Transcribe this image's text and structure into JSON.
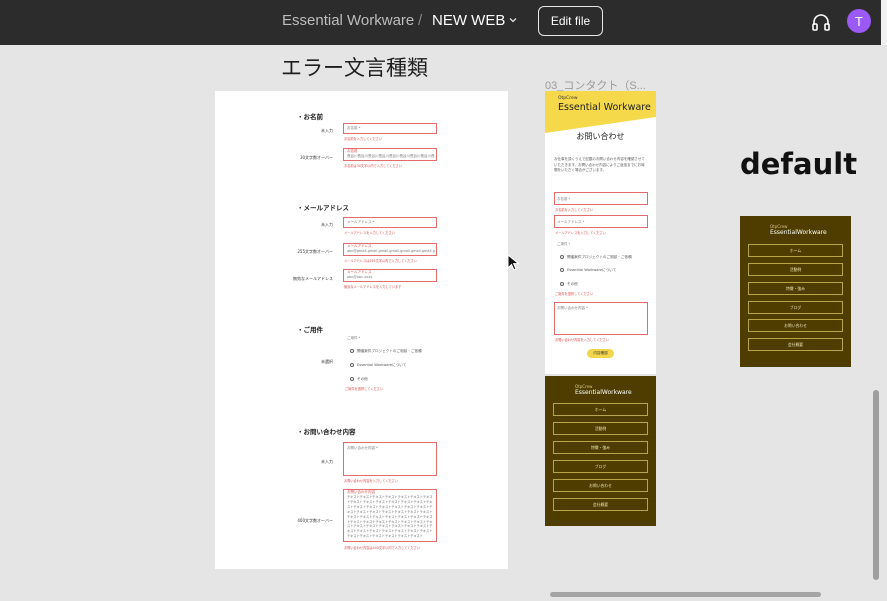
{
  "header": {
    "project": "Essential Workware",
    "separator": "/",
    "file": "NEW WEB",
    "edit_button": "Edit file",
    "avatar_initial": "T",
    "avatar_color": "#9b59f5"
  },
  "canvas": {
    "page_title": "エラー文言種類",
    "contact_frame_label": "03_コンタクト（S...",
    "default_title": "default"
  },
  "error_doc": {
    "sections": [
      {
        "head": "・お名前"
      },
      {
        "head": "・メールアドレス"
      },
      {
        "head": "・ご用件"
      },
      {
        "head": "・お問い合わせ内容"
      }
    ],
    "name_rows": [
      {
        "label": "未入力",
        "placeholder": "お名前 *",
        "error": "お名前を入力してください"
      },
      {
        "label": "30文字数オーバー",
        "placeholder": "お名前",
        "value": "長谷川長谷川長谷川長谷川長谷川長谷川長谷川長谷川長谷川長谷川",
        "error": "お名前は30文字以内で入力してください"
      }
    ],
    "email_rows": [
      {
        "label": "未入力",
        "placeholder": "メールアドレス *",
        "error": "メールアドレスを入力してください"
      },
      {
        "label": "255文字数オーバー",
        "placeholder": "メールアドレス",
        "value": "abc@gmail.gmail.gmail.gmail.gmail.gmail.gmail.gmail.gmail",
        "error": "メールアドレスは255文字以内で入力してください"
      },
      {
        "label": "無効なメールアドレス",
        "placeholder": "メールアドレス",
        "value": "abc@abc.xxxx",
        "error": "無効なメールアドレスを入力しています"
      }
    ],
    "purpose": {
      "label": "未選択",
      "heading": "ご用件 *",
      "options": [
        "開催案件プロジェクトのご相談・ご依頼",
        "Essential Workwareについて",
        "その他"
      ],
      "error": "ご用件を選択してください"
    },
    "inquiry_rows": [
      {
        "label": "未入力",
        "placeholder": "お問い合わせ内容 *",
        "error": "お問い合わせ内容を入力してください"
      },
      {
        "label": "400文字数オーバー",
        "placeholder": "お問い合わせ内容",
        "value": "テキストテキストテキストテキストテキストテキストテキストテキストテキストテキストテキストテキストテキストテキストテキストテキストテキストテキストテキストテキストテキストテキストテキストテキストテキストテキストテキストテキストテキストテキストテキストテキストテキストテキストテキストテキストテキストテキストテキストテキストテキストテキストテキストテキストテキストテキストテキストテキストテキストテキストテキストテキストテキストテキストテキストテキストテキストテキストテキストテキスト",
        "error": "お問い合わせ内容は400文字以内で入力してください"
      }
    ]
  },
  "contact_frame": {
    "brand_small": "OtpCrew",
    "brand_big": "Essential Workware",
    "title": "お問い合わせ",
    "description": "お仕事を頂くうえで記載のお問い合わせ内容を確認させていただきます。お問い合わせ内容によりご返信までにお時間をいただく場合がございます。",
    "name_placeholder": "お名前 *",
    "name_error": "お名前を入力してください",
    "email_placeholder": "メールアドレス *",
    "email_error": "メールアドレスを入力してください",
    "purpose_heading": "ご用件 *",
    "options": [
      "開催案件プロジェクトのご相談・ご依頼",
      "Essential Workwareについて",
      "その他"
    ],
    "purpose_error": "ご用件を選択してください",
    "message_placeholder": "お問い合わせ内容 *",
    "message_error": "お問い合わせ内容を入力してください",
    "send": "内容確認"
  },
  "menu": {
    "brand_small": "OtpCrew",
    "brand_big": "EssentialWorkware",
    "items": [
      "ホーム",
      "活動例",
      "特徴・強み",
      "ブログ",
      "お問い合わせ",
      "会社概要"
    ]
  },
  "colors": {
    "topbar": "#2c2c2c",
    "error": "#e46b6b",
    "accent": "#f5d94a",
    "menu_bg": "#4f3d00"
  }
}
